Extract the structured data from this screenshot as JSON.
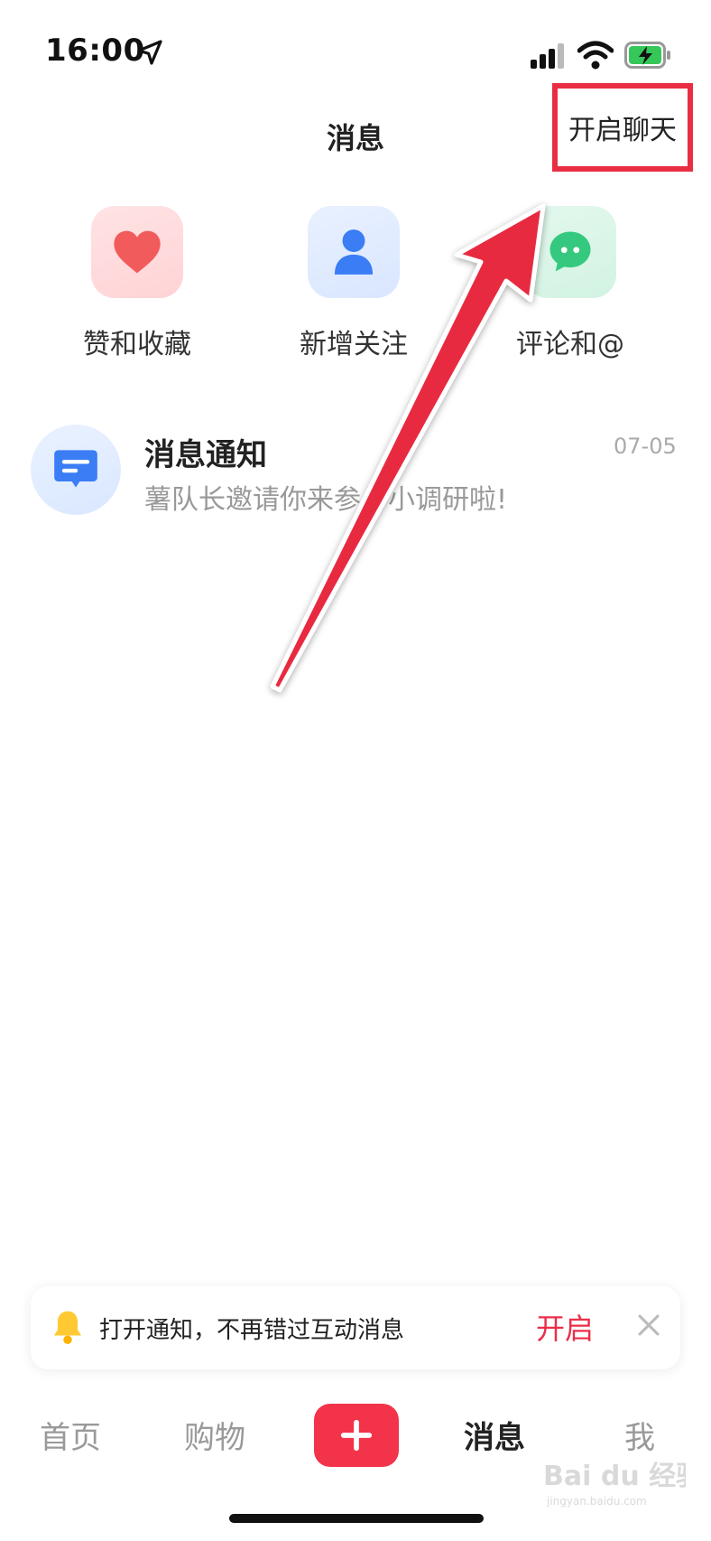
{
  "status_bar": {
    "time": "16:00",
    "icons": [
      "location-arrow-icon",
      "signal-icon",
      "wifi-icon",
      "battery-charging-icon"
    ]
  },
  "header": {
    "title": "消息",
    "open_chat_label": "开启聊天",
    "highlight_color": "#e92e43"
  },
  "quick_entries": [
    {
      "label": "赞和收藏",
      "icon": "heart-icon",
      "color": "#f25b5b"
    },
    {
      "label": "新增关注",
      "icon": "person-icon",
      "color": "#3a7df5"
    },
    {
      "label": "评论和@",
      "icon": "chat-bubble-icon",
      "color": "#34c97e"
    }
  ],
  "messages": [
    {
      "title": "消息通知",
      "preview": "薯队长邀请你来参与小调研啦!",
      "time": "07-05",
      "icon": "notice-message-icon"
    }
  ],
  "annotation": {
    "arrow_color": "#e8293f"
  },
  "notification_banner": {
    "text": "打开通知，不再错过互动消息",
    "action_label": "开启",
    "action_color": "#ec2e4a",
    "icons": [
      "bell-icon",
      "close-icon"
    ]
  },
  "tab_bar": {
    "home": "首页",
    "shop": "购物",
    "messages": "消息",
    "me": "我",
    "publish_icon": "plus-icon",
    "accent_color": "#f2334a"
  },
  "watermark": {
    "text": "Bai du 经验",
    "subtext": "jingyan.baidu.com"
  }
}
